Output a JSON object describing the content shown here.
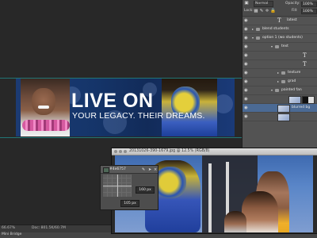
{
  "document": {
    "banner_title": "LIVE ON",
    "banner_subtitle": "YOUR LEGACY. THEIR DREAMS."
  },
  "status_bar": {
    "zoom": "66.67%",
    "doc_info": "Doc: 801.5K/60.7M"
  },
  "bottom_tab": "Mini Bridge",
  "layers_panel": {
    "blend_mode": "Normal",
    "opacity_label": "Opacity:",
    "opacity_value": "100%",
    "lock_label": "Lock:",
    "fill_label": "Fill:",
    "fill_value": "100%",
    "layers": [
      {
        "name": "latest",
        "kind": "text"
      },
      {
        "name": "blend students",
        "kind": "group"
      },
      {
        "name": "option 1 (wo students)",
        "kind": "group"
      },
      {
        "name": "text",
        "kind": "group"
      },
      {
        "name": "",
        "kind": "text"
      },
      {
        "name": "",
        "kind": "text"
      },
      {
        "name": "texture",
        "kind": "group"
      },
      {
        "name": "grad",
        "kind": "group"
      },
      {
        "name": "painted fan",
        "kind": "group"
      },
      {
        "name": "",
        "kind": "image"
      },
      {
        "name": "blurred bg",
        "kind": "image"
      },
      {
        "name": "",
        "kind": "image"
      }
    ]
  },
  "image_window": {
    "title": "20131026-390-1679.jpg @ 12.5% (RGB/8)"
  },
  "info_panel": {
    "hex_value": "#4e6757",
    "swatch_color": "#4e6757",
    "width_value": "160 px",
    "height_value": "105 px"
  }
}
